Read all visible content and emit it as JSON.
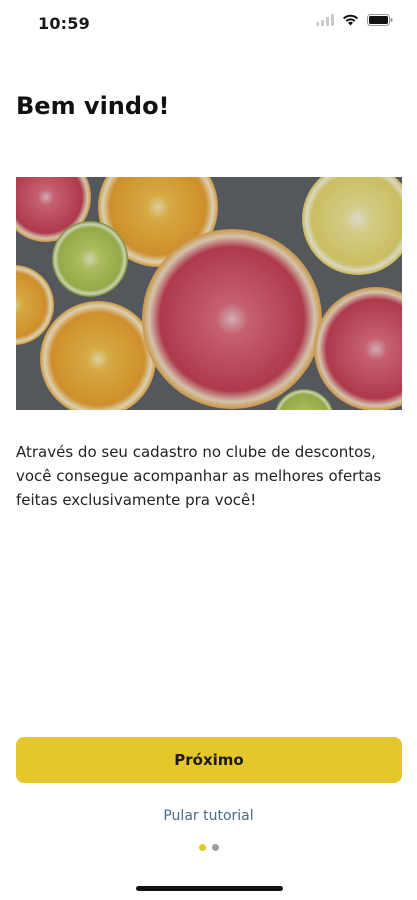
{
  "status_bar": {
    "time": "10:59",
    "icons": [
      "signal-icon",
      "wifi-icon",
      "battery-icon"
    ]
  },
  "onboarding": {
    "title": "Bem vindo!",
    "image": "citrus-fruit-slices-image",
    "description": "Através do seu cadastro no clube de descontos, você consegue acompanhar as melhores ofertas feitas exclusivamente pra você!",
    "primary_button_label": "Próximo",
    "skip_label": "Pular tutorial",
    "pager": {
      "total": 2,
      "current": 1
    }
  },
  "colors": {
    "accent": "#e5c62b",
    "skip_link": "#4a6a86",
    "dot_active": "#e5c62b",
    "dot_inactive": "#9e9e9e"
  }
}
